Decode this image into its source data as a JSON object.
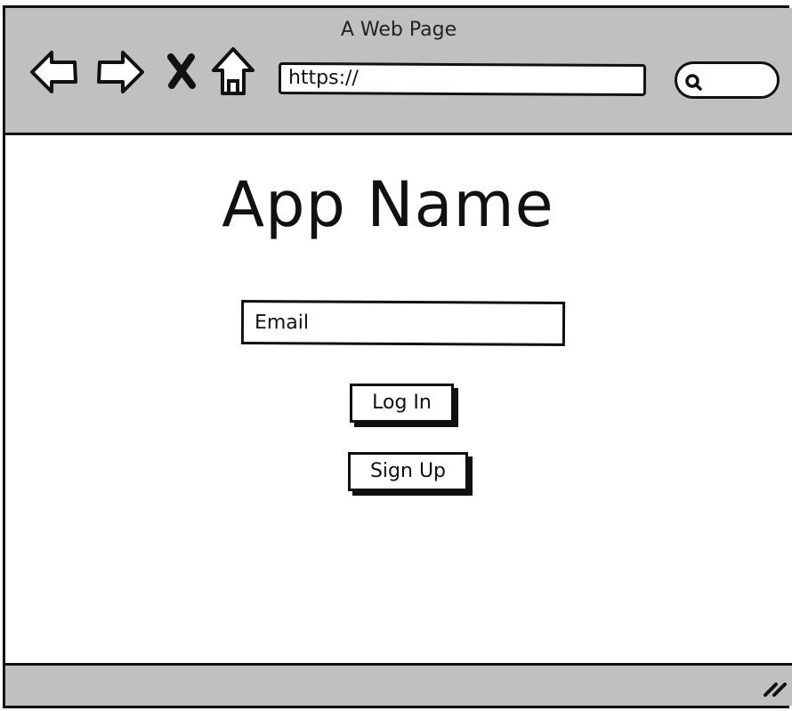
{
  "browser": {
    "window_title": "A Web Page",
    "url": "https://",
    "icons": {
      "back": "back-arrow-icon",
      "forward": "forward-arrow-icon",
      "stop": "close-icon",
      "home": "home-icon",
      "search": "search-icon",
      "resize": "resize-grip-icon"
    }
  },
  "app": {
    "title": "App Name",
    "email_placeholder": "Email",
    "login_label": "Log In",
    "signup_label": "Sign Up"
  },
  "colors": {
    "chrome": "#c0c0c0",
    "ink": "#111111",
    "page": "#ffffff"
  }
}
